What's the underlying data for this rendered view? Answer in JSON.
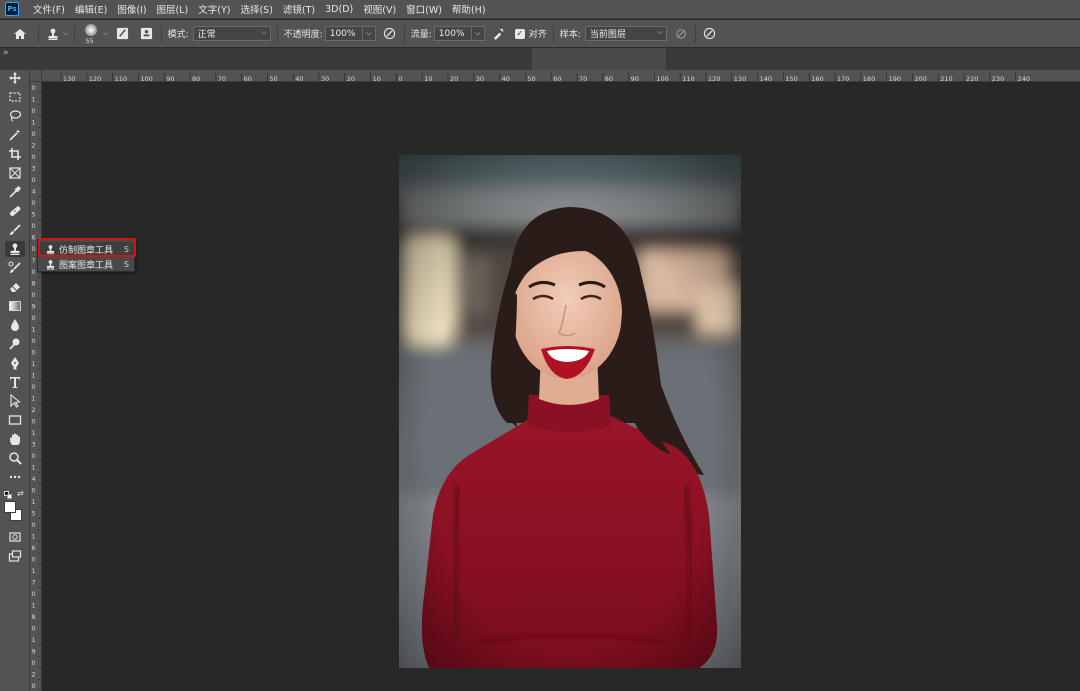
{
  "app": {
    "logo": "Ps"
  },
  "menu": [
    "文件(F)",
    "编辑(E)",
    "图像(I)",
    "图层(L)",
    "文字(Y)",
    "选择(S)",
    "滤镜(T)",
    "3D(D)",
    "视图(V)",
    "窗口(W)",
    "帮助(H)"
  ],
  "options": {
    "brush_size": "55",
    "mode_label": "模式:",
    "mode_value": "正常",
    "opacity_label": "不透明度:",
    "opacity_value": "100%",
    "flow_label": "流量:",
    "flow_value": "100%",
    "aligned_label": "对齐",
    "aligned_checked": true,
    "sample_label": "样本:",
    "sample_value": "当前图层"
  },
  "rulers": {
    "top_ticks": [
      "130",
      "120",
      "110",
      "100",
      "90",
      "80",
      "70",
      "60",
      "50",
      "40",
      "30",
      "20",
      "10",
      "0",
      "10",
      "20",
      "30",
      "40",
      "50",
      "60",
      "70",
      "80",
      "90",
      "100",
      "110",
      "120",
      "130",
      "140",
      "150",
      "160",
      "170",
      "180",
      "190",
      "200",
      "210",
      "220",
      "230",
      "240"
    ],
    "left_ticks": [
      "0",
      "1",
      "0",
      "1",
      "0",
      "2",
      "0",
      "3",
      "0",
      "4",
      "0",
      "5",
      "0",
      "6",
      "0",
      "7",
      "0",
      "8",
      "0",
      "9",
      "0",
      "1",
      "0",
      "0",
      "1",
      "1",
      "0",
      "1",
      "2",
      "0",
      "1",
      "3",
      "0",
      "1",
      "4",
      "0",
      "1",
      "5",
      "0",
      "1",
      "6",
      "0",
      "1",
      "7",
      "0",
      "1",
      "8",
      "0",
      "1",
      "9",
      "0",
      "2",
      "0"
    ]
  },
  "flyout": {
    "items": [
      {
        "label": "仿制图章工具",
        "key": "S",
        "icon": "clone-stamp-icon"
      },
      {
        "label": "图案图章工具",
        "key": "S",
        "icon": "pattern-stamp-icon"
      }
    ]
  },
  "colors": {
    "panel": "#535353",
    "canvas_bg": "#282828",
    "highlight": "#d0141a",
    "sweater": "#8a1024"
  }
}
